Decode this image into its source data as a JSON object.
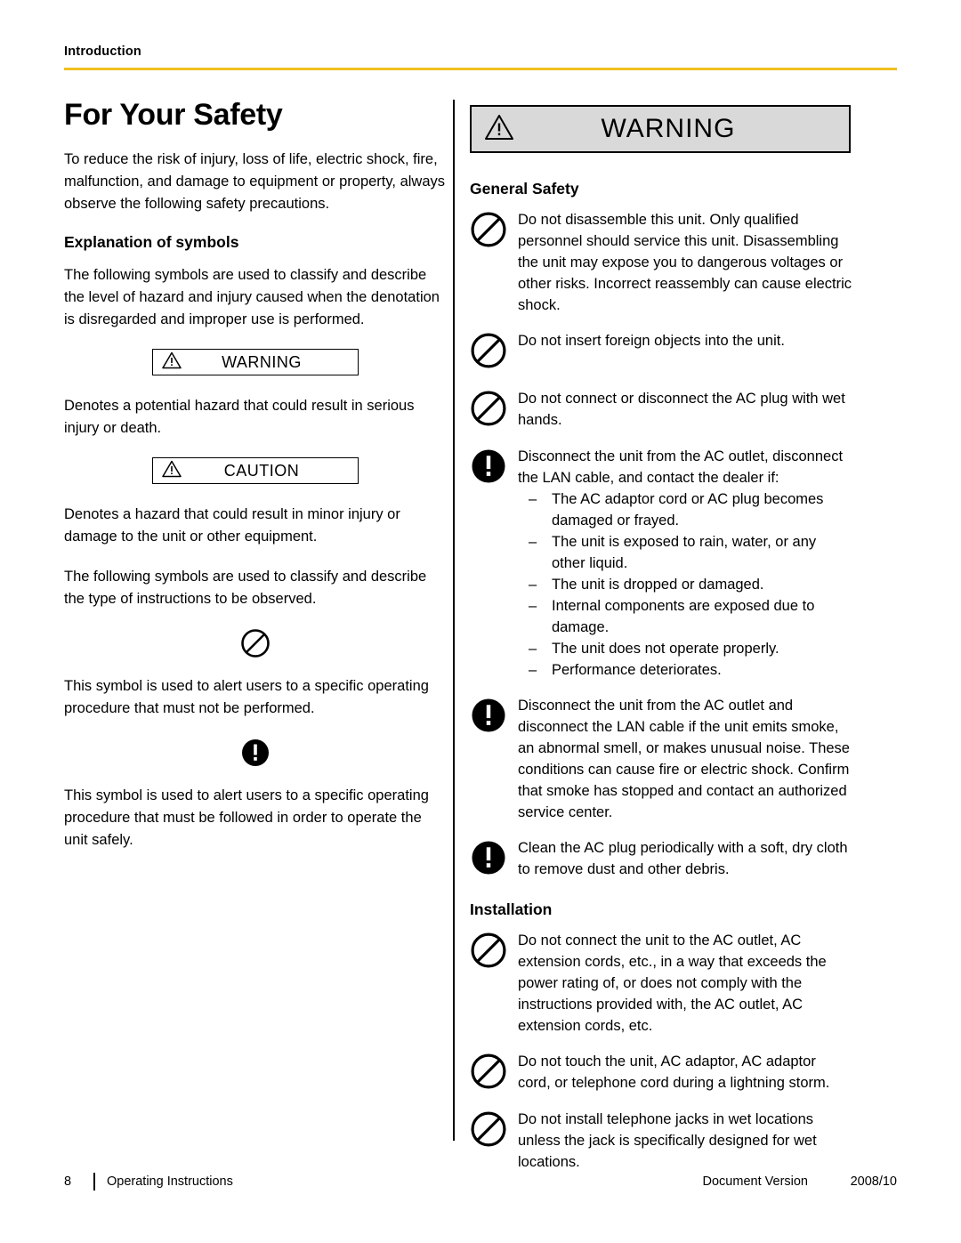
{
  "header": {
    "label": "Introduction"
  },
  "left": {
    "title": "For Your Safety",
    "intro": "To reduce the risk of injury, loss of life, electric shock, fire, malfunction, and damage to equipment or property, always observe the following safety precautions.",
    "explanation_heading": "Explanation of symbols",
    "explanation_para": "The following symbols are used to classify and describe the level of hazard and injury caused when the denotation is disregarded and improper use is performed.",
    "warning_label": "WARNING",
    "warning_desc": "Denotes a potential hazard that could result in serious injury or death.",
    "caution_label": "CAUTION",
    "caution_desc": "Denotes a hazard that could result in minor injury or damage to the unit or other equipment.",
    "symbols_para": "The following symbols are used to classify and describe the type of instructions to be observed.",
    "prohibition_desc": "This symbol is used to alert users to a specific operating procedure that must not be performed.",
    "mandatory_desc": "This symbol is used to alert users to a specific operating procedure that must be followed in order to operate the unit safely."
  },
  "right": {
    "banner_label": "WARNING",
    "general_safety_heading": "General Safety",
    "general_items": [
      {
        "icon": "prohibition-icon",
        "text": "Do not disassemble this unit. Only qualified personnel should service this unit. Disassembling the unit may expose you to dangerous voltages or other risks. Incorrect reassembly can cause electric shock."
      },
      {
        "icon": "prohibition-icon",
        "text": "Do not insert foreign objects into the unit."
      },
      {
        "icon": "prohibition-icon",
        "text": "Do not connect or disconnect the AC plug with wet hands."
      },
      {
        "icon": "mandatory-icon",
        "text": "Disconnect the unit from the AC outlet, disconnect the LAN cable, and contact the dealer if:",
        "sublist": [
          "The AC adaptor cord or AC plug becomes damaged or frayed.",
          "The unit is exposed to rain, water, or any other liquid.",
          "The unit is dropped or damaged.",
          "Internal components are exposed due to damage.",
          "The unit does not operate properly.",
          "Performance deteriorates."
        ]
      },
      {
        "icon": "mandatory-icon",
        "text": "Disconnect the unit from the AC outlet and disconnect the LAN cable if the unit emits smoke, an abnormal smell, or makes unusual noise. These conditions can cause fire or electric shock. Confirm that smoke has stopped and contact an authorized service center."
      },
      {
        "icon": "mandatory-icon",
        "text": "Clean the AC plug periodically with a soft, dry cloth to remove dust and other debris."
      }
    ],
    "installation_heading": "Installation",
    "installation_items": [
      {
        "icon": "prohibition-icon",
        "text": "Do not connect the unit to the AC outlet, AC extension cords, etc., in a way that exceeds the power rating of, or does not comply with the instructions provided with, the AC outlet, AC extension cords, etc."
      },
      {
        "icon": "prohibition-icon",
        "text": "Do not touch the unit, AC adaptor, AC adaptor cord, or telephone cord during a lightning storm."
      },
      {
        "icon": "prohibition-icon",
        "text": "Do not install telephone jacks in wet locations unless the jack is specifically designed for wet locations."
      }
    ]
  },
  "footer": {
    "page_number": "8",
    "doc_name": "Operating Instructions",
    "doc_version_label": "Document Version",
    "doc_version_value": "2008/10"
  },
  "colors": {
    "rule": "#f0c020",
    "banner_bg": "#d9d9d9"
  }
}
